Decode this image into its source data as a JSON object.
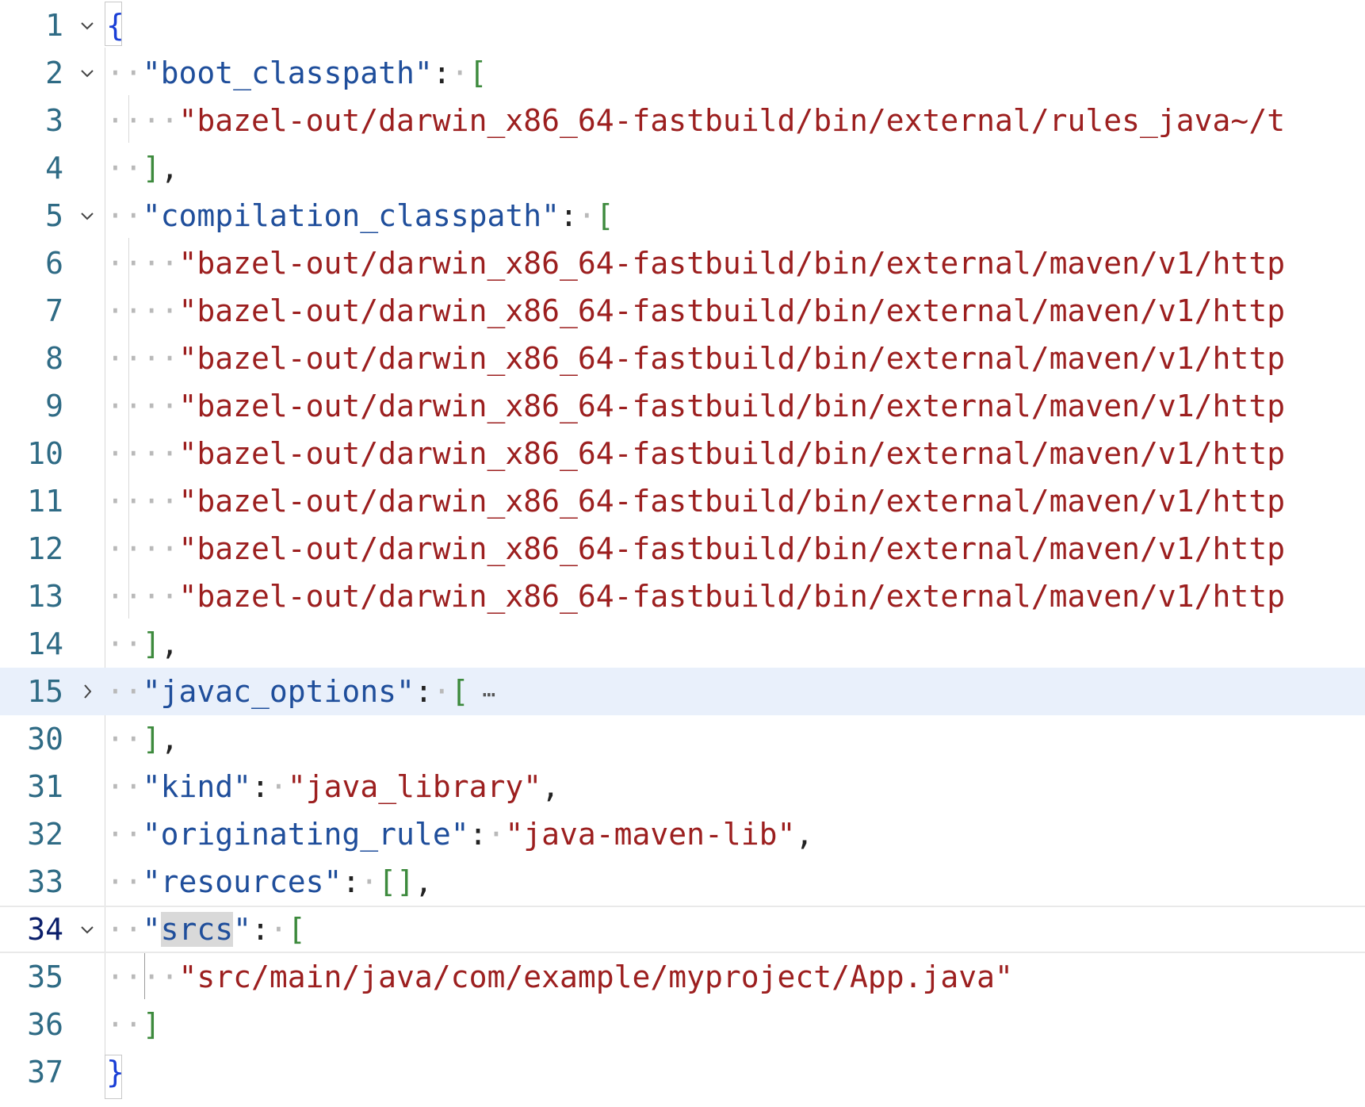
{
  "editor": {
    "folded_placeholder": "⋯",
    "lines": [
      {
        "num": "1",
        "fold": "open",
        "tokens": [
          {
            "c": "br-obj",
            "t": "{"
          }
        ]
      },
      {
        "num": "2",
        "fold": "open",
        "tokens": [
          {
            "c": "ws",
            "t": "··"
          },
          {
            "c": "key",
            "t": "\"boot_classpath\""
          },
          {
            "c": "punc",
            "t": ":"
          },
          {
            "c": "ws",
            "t": "·"
          },
          {
            "c": "br-arr",
            "t": "["
          }
        ]
      },
      {
        "num": "3",
        "fold": "",
        "tokens": [
          {
            "c": "ws",
            "t": "····"
          },
          {
            "c": "str",
            "t": "\"bazel-out/darwin_x86_64-fastbuild/bin/external/rules_java~/t"
          }
        ]
      },
      {
        "num": "4",
        "fold": "",
        "tokens": [
          {
            "c": "ws",
            "t": "··"
          },
          {
            "c": "br-arr",
            "t": "]"
          },
          {
            "c": "punc",
            "t": ","
          }
        ]
      },
      {
        "num": "5",
        "fold": "open",
        "tokens": [
          {
            "c": "ws",
            "t": "··"
          },
          {
            "c": "key",
            "t": "\"compilation_classpath\""
          },
          {
            "c": "punc",
            "t": ":"
          },
          {
            "c": "ws",
            "t": "·"
          },
          {
            "c": "br-arr",
            "t": "["
          }
        ]
      },
      {
        "num": "6",
        "fold": "",
        "tokens": [
          {
            "c": "ws",
            "t": "····"
          },
          {
            "c": "str",
            "t": "\"bazel-out/darwin_x86_64-fastbuild/bin/external/maven/v1/http"
          }
        ]
      },
      {
        "num": "7",
        "fold": "",
        "tokens": [
          {
            "c": "ws",
            "t": "····"
          },
          {
            "c": "str",
            "t": "\"bazel-out/darwin_x86_64-fastbuild/bin/external/maven/v1/http"
          }
        ]
      },
      {
        "num": "8",
        "fold": "",
        "tokens": [
          {
            "c": "ws",
            "t": "····"
          },
          {
            "c": "str",
            "t": "\"bazel-out/darwin_x86_64-fastbuild/bin/external/maven/v1/http"
          }
        ]
      },
      {
        "num": "9",
        "fold": "",
        "tokens": [
          {
            "c": "ws",
            "t": "····"
          },
          {
            "c": "str",
            "t": "\"bazel-out/darwin_x86_64-fastbuild/bin/external/maven/v1/http"
          }
        ]
      },
      {
        "num": "10",
        "fold": "",
        "tokens": [
          {
            "c": "ws",
            "t": "····"
          },
          {
            "c": "str",
            "t": "\"bazel-out/darwin_x86_64-fastbuild/bin/external/maven/v1/http"
          }
        ]
      },
      {
        "num": "11",
        "fold": "",
        "tokens": [
          {
            "c": "ws",
            "t": "····"
          },
          {
            "c": "str",
            "t": "\"bazel-out/darwin_x86_64-fastbuild/bin/external/maven/v1/http"
          }
        ]
      },
      {
        "num": "12",
        "fold": "",
        "tokens": [
          {
            "c": "ws",
            "t": "····"
          },
          {
            "c": "str",
            "t": "\"bazel-out/darwin_x86_64-fastbuild/bin/external/maven/v1/http"
          }
        ]
      },
      {
        "num": "13",
        "fold": "",
        "tokens": [
          {
            "c": "ws",
            "t": "····"
          },
          {
            "c": "str",
            "t": "\"bazel-out/darwin_x86_64-fastbuild/bin/external/maven/v1/http"
          }
        ]
      },
      {
        "num": "14",
        "fold": "",
        "tokens": [
          {
            "c": "ws",
            "t": "··"
          },
          {
            "c": "br-arr",
            "t": "]"
          },
          {
            "c": "punc",
            "t": ","
          }
        ]
      },
      {
        "num": "15",
        "fold": "closed",
        "folded": true,
        "tokens": [
          {
            "c": "ws",
            "t": "··"
          },
          {
            "c": "key",
            "t": "\"javac_options\""
          },
          {
            "c": "punc",
            "t": ":"
          },
          {
            "c": "ws",
            "t": "·"
          },
          {
            "c": "br-arr",
            "t": "["
          }
        ]
      },
      {
        "num": "30",
        "fold": "",
        "tokens": [
          {
            "c": "ws",
            "t": "··"
          },
          {
            "c": "br-arr",
            "t": "]"
          },
          {
            "c": "punc",
            "t": ","
          }
        ]
      },
      {
        "num": "31",
        "fold": "",
        "tokens": [
          {
            "c": "ws",
            "t": "··"
          },
          {
            "c": "key",
            "t": "\"kind\""
          },
          {
            "c": "punc",
            "t": ":"
          },
          {
            "c": "ws",
            "t": "·"
          },
          {
            "c": "str",
            "t": "\"java_library\""
          },
          {
            "c": "punc",
            "t": ","
          }
        ]
      },
      {
        "num": "32",
        "fold": "",
        "tokens": [
          {
            "c": "ws",
            "t": "··"
          },
          {
            "c": "key",
            "t": "\"originating_rule\""
          },
          {
            "c": "punc",
            "t": ":"
          },
          {
            "c": "ws",
            "t": "·"
          },
          {
            "c": "str",
            "t": "\"java-maven-lib\""
          },
          {
            "c": "punc",
            "t": ","
          }
        ]
      },
      {
        "num": "33",
        "fold": "",
        "tokens": [
          {
            "c": "ws",
            "t": "··"
          },
          {
            "c": "key",
            "t": "\"resources\""
          },
          {
            "c": "punc",
            "t": ":"
          },
          {
            "c": "ws",
            "t": "·"
          },
          {
            "c": "br-arr",
            "t": "[]"
          },
          {
            "c": "punc",
            "t": ","
          }
        ]
      },
      {
        "num": "34",
        "fold": "open",
        "active": true,
        "tokens": [
          {
            "c": "ws",
            "t": "··"
          },
          {
            "c": "key",
            "t": "\""
          },
          {
            "c": "key hl",
            "t": "srcs"
          },
          {
            "c": "key",
            "t": "\""
          },
          {
            "c": "punc",
            "t": ":"
          },
          {
            "c": "ws",
            "t": "·"
          },
          {
            "c": "br-arr",
            "t": "["
          }
        ]
      },
      {
        "num": "35",
        "fold": "",
        "tokens": [
          {
            "c": "ws",
            "t": "····"
          },
          {
            "c": "str",
            "t": "\"src/main/java/com/example/myproject/App.java\""
          }
        ]
      },
      {
        "num": "36",
        "fold": "",
        "tokens": [
          {
            "c": "ws",
            "t": "··"
          },
          {
            "c": "br-arr",
            "t": "]"
          }
        ]
      },
      {
        "num": "37",
        "fold": "",
        "tokens": [
          {
            "c": "br-obj",
            "t": "}"
          }
        ]
      }
    ]
  },
  "icons": {
    "open": "chevron-down-icon",
    "closed": "chevron-right-icon"
  }
}
